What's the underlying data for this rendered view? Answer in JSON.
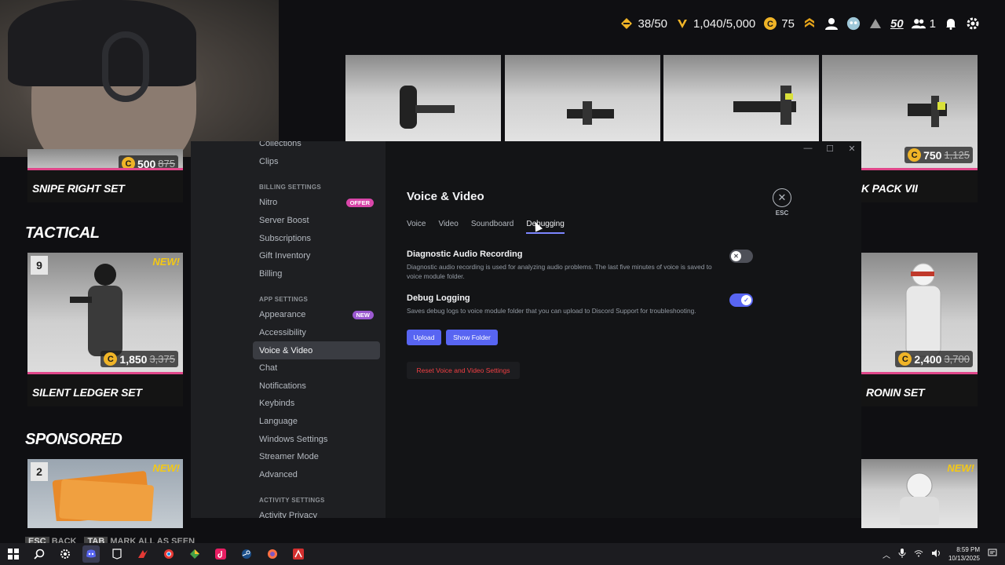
{
  "game": {
    "currency": {
      "tier_value": "38/50",
      "progress_value": "1,040/5,000",
      "coins": "75",
      "level": "50",
      "friends": "1"
    },
    "sections": {
      "tactical": "TACTICAL",
      "sponsored": "SPONSORED"
    },
    "cards": [
      {
        "name": "SNIPE RIGHT SET",
        "price": "500",
        "old_price": "875"
      },
      {
        "name": "K PACK VII",
        "price": "750",
        "old_price": "1,125"
      },
      {
        "name": "SILENT LEDGER SET",
        "price": "1,850",
        "old_price": "3,375",
        "number": "9",
        "badge": "NEW!"
      },
      {
        "name": "RONIN SET",
        "price": "2,400",
        "old_price": "3,700"
      },
      {
        "number": "2",
        "badge": "NEW!"
      },
      {
        "badge": "NEW!"
      }
    ],
    "bottom_hints": [
      {
        "key": "ESC",
        "label": "BACK"
      },
      {
        "key": "TAB",
        "label": "MARK ALL AS SEEN"
      }
    ],
    "coin_symbol": "C"
  },
  "discord": {
    "window_controls": [
      "—",
      "☐",
      "✕"
    ],
    "sidebar": {
      "top_items": [
        {
          "label": "Collections"
        },
        {
          "label": "Clips"
        }
      ],
      "billing_header": "BILLING SETTINGS",
      "billing_items": [
        {
          "label": "Nitro",
          "pill": "OFFER"
        },
        {
          "label": "Server Boost"
        },
        {
          "label": "Subscriptions"
        },
        {
          "label": "Gift Inventory"
        },
        {
          "label": "Billing"
        }
      ],
      "app_header": "APP SETTINGS",
      "app_items": [
        {
          "label": "Appearance",
          "pill": "NEW"
        },
        {
          "label": "Accessibility"
        },
        {
          "label": "Voice & Video",
          "active": true
        },
        {
          "label": "Chat"
        },
        {
          "label": "Notifications"
        },
        {
          "label": "Keybinds"
        },
        {
          "label": "Language"
        },
        {
          "label": "Windows Settings"
        },
        {
          "label": "Streamer Mode"
        },
        {
          "label": "Advanced"
        }
      ],
      "activity_header": "ACTIVITY SETTINGS",
      "activity_items": [
        {
          "label": "Activity Privacy"
        }
      ]
    },
    "main": {
      "title": "Voice & Video",
      "esc_label": "ESC",
      "tabs": [
        {
          "label": "Voice"
        },
        {
          "label": "Video"
        },
        {
          "label": "Soundboard"
        },
        {
          "label": "Debugging",
          "active": true
        }
      ],
      "options": [
        {
          "title": "Diagnostic Audio Recording",
          "description": "Diagnostic audio recording is used for analyzing audio problems. The last five minutes of voice is saved to voice module folder.",
          "enabled": false
        },
        {
          "title": "Debug Logging",
          "description": "Saves debug logs to voice module folder that you can upload to Discord Support for troubleshooting.",
          "enabled": true
        }
      ],
      "upload_label": "Upload",
      "show_folder_label": "Show Folder",
      "reset_label": "Reset Voice and Video Settings"
    },
    "colors": {
      "accent": "#5865f2",
      "danger": "#f23f43"
    }
  },
  "taskbar": {
    "time": "8:59 PM",
    "date": "10/13/2025"
  }
}
